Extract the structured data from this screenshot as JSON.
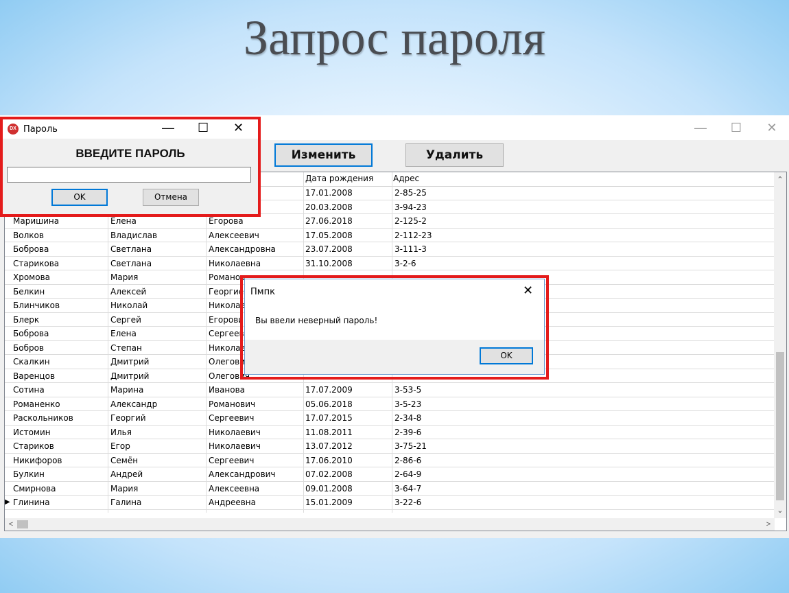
{
  "slide": {
    "title": "Запрос пароля"
  },
  "main_window": {
    "controls": {
      "minimize": "—",
      "maximize": "☐",
      "close": "✕"
    },
    "buttons": {
      "edit": "Изменить",
      "delete": "Удалить"
    },
    "grid": {
      "visible_headers": [
        "Дата рождения",
        "Адрес"
      ],
      "rows": [
        [
          "",
          "",
          "",
          "17.01.2008",
          "2-85-25"
        ],
        [
          "",
          "",
          "",
          "20.03.2008",
          "3-94-23"
        ],
        [
          "Маришина",
          "Елена",
          "Егорова",
          "27.06.2018",
          "2-125-2"
        ],
        [
          "Волков",
          "Владислав",
          "Алексеевич",
          "17.05.2008",
          "2-112-23"
        ],
        [
          "Боброва",
          "Светлана",
          "Александровна",
          "23.07.2008",
          "3-111-3"
        ],
        [
          "Старикова",
          "Светлана",
          "Николаевна",
          "31.10.2008",
          "3-2-6"
        ],
        [
          "Хромова",
          "Мария",
          "Романов",
          "",
          ""
        ],
        [
          "Белкин",
          "Алексей",
          "Георгиев",
          "",
          ""
        ],
        [
          "Блинчиков",
          "Николай",
          "Николае",
          "",
          ""
        ],
        [
          "Блерк",
          "Сергей",
          "Егорови",
          "",
          ""
        ],
        [
          "Боброва",
          "Елена",
          "Сергеев",
          "",
          ""
        ],
        [
          "Бобров",
          "Степан",
          "Николае",
          "",
          ""
        ],
        [
          "Скалкин",
          "Дмитрий",
          "Олегови",
          "",
          ""
        ],
        [
          "Варенцов",
          "Дмитрий",
          "Олегович",
          "",
          ""
        ],
        [
          "Сотина",
          "Марина",
          "Иванова",
          "17.07.2009",
          "3-53-5"
        ],
        [
          "Романенко",
          "Александр",
          "Романович",
          "05.06.2018",
          "3-5-23"
        ],
        [
          "Раскольников",
          "Георгий",
          "Сергеевич",
          "17.07.2015",
          "2-34-8"
        ],
        [
          "Истомин",
          "Илья",
          "Николаевич",
          "11.08.2011",
          "2-39-6"
        ],
        [
          "Стариков",
          "Егор",
          "Николаевич",
          "13.07.2012",
          "3-75-21"
        ],
        [
          "Никифоров",
          "Семён",
          "Сергеевич",
          "17.06.2010",
          "2-86-6"
        ],
        [
          "Булкин",
          "Андрей",
          "Александрович",
          "07.02.2008",
          "2-64-9"
        ],
        [
          "Смирнова",
          "Мария",
          "Алексеевна",
          "09.01.2008",
          "3-64-7"
        ],
        [
          "Глинина",
          "Галина",
          "Андреевна",
          "15.01.2009",
          "3-22-6"
        ]
      ],
      "current_row_marker": "▶"
    },
    "scroll": {
      "up": "⌃",
      "down": "⌄",
      "left": "<",
      "right": ">"
    }
  },
  "password_dialog": {
    "title": "Пароль",
    "app_icon_text": "DX",
    "heading": "ВВЕДИТЕ ПАРОЛЬ",
    "password_value": "",
    "ok_label": "OK",
    "cancel_label": "Отмена",
    "controls": {
      "minimize": "—",
      "maximize": "☐",
      "close": "✕"
    }
  },
  "error_dialog": {
    "title": "Пмпк",
    "message": "Вы ввели неверный пароль!",
    "ok_label": "OK",
    "close": "✕"
  },
  "colors": {
    "highlight_frame": "#e41b1b",
    "focus_border": "#0078d7"
  }
}
